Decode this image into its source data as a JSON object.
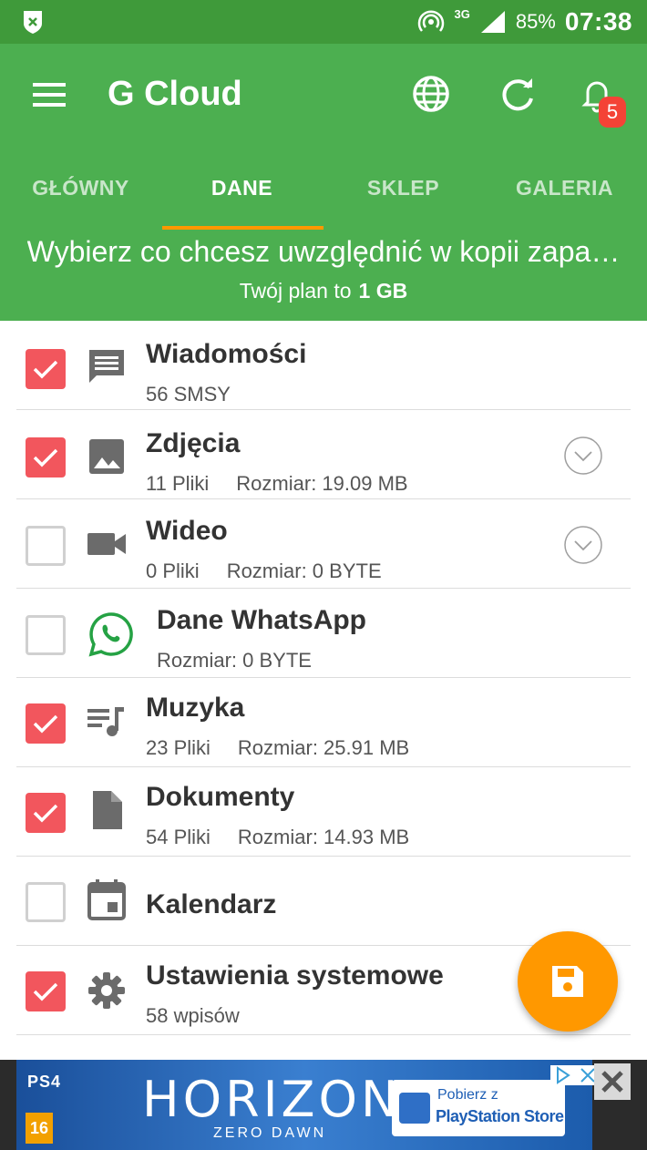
{
  "status_bar": {
    "network": "3G",
    "battery": "85%",
    "time": "07:38"
  },
  "app_bar": {
    "title": "G Cloud",
    "notification_count": "5"
  },
  "tabs": [
    {
      "label": "GŁÓWNY",
      "active": false
    },
    {
      "label": "DANE",
      "active": true
    },
    {
      "label": "SKLEP",
      "active": false
    },
    {
      "label": "GALERIA",
      "active": false
    }
  ],
  "header": {
    "headline": "Wybierz co chcesz uwzględnić w kopii zapa…",
    "plan_label": "Twój plan to",
    "plan_value": "1 GB"
  },
  "items": [
    {
      "title": "Wiadomości",
      "count": "56 SMSY",
      "size": "",
      "checked": true,
      "icon": "message-icon",
      "expandable": false
    },
    {
      "title": "Zdjęcia",
      "count": "11 Pliki",
      "size": "Rozmiar: 19.09 MB",
      "checked": true,
      "icon": "image-icon",
      "expandable": true
    },
    {
      "title": "Wideo",
      "count": "0 Pliki",
      "size": "Rozmiar: 0 BYTE",
      "checked": false,
      "icon": "video-icon",
      "expandable": true
    },
    {
      "title": "Dane WhatsApp",
      "count": "",
      "size": "Rozmiar: 0 BYTE",
      "checked": false,
      "icon": "whatsapp-icon",
      "expandable": false
    },
    {
      "title": "Muzyka",
      "count": "23 Pliki",
      "size": "Rozmiar: 25.91 MB",
      "checked": true,
      "icon": "music-icon",
      "expandable": false
    },
    {
      "title": "Dokumenty",
      "count": "54 Pliki",
      "size": "Rozmiar: 14.93 MB",
      "checked": true,
      "icon": "document-icon",
      "expandable": false
    },
    {
      "title": "Kalendarz",
      "count": "",
      "size": "",
      "checked": false,
      "icon": "calendar-icon",
      "expandable": false
    },
    {
      "title": "Ustawienia systemowe",
      "count": "58 wpisów",
      "size": "",
      "checked": true,
      "icon": "gear-icon",
      "expandable": false
    }
  ],
  "ad": {
    "platform": "PS4",
    "game_title": "HORIZON",
    "game_subtitle": "ZERO DAWN",
    "age_rating": "16",
    "store_line1": "Pobierz z",
    "store_line2": "PlayStation Store"
  },
  "colors": {
    "primary": "#4caf50",
    "status_bar": "#3f9a3a",
    "accent": "#ff9800",
    "checkbox": "#f2565d"
  }
}
